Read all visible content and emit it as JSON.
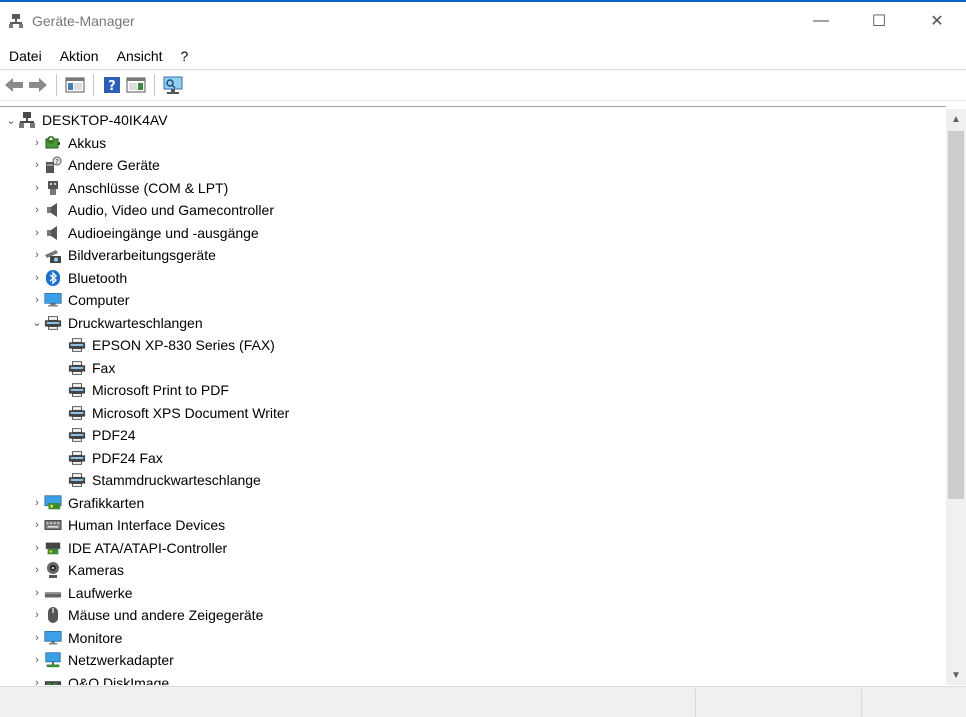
{
  "window": {
    "title": "Geräte-Manager",
    "controls": [
      "—",
      "☐",
      "✕"
    ]
  },
  "menu": [
    "Datei",
    "Aktion",
    "Ansicht",
    "?"
  ],
  "toolbar": {
    "buttons": [
      "back-arrow-icon",
      "forward-arrow-icon",
      "console-tree-icon",
      "help-icon",
      "action-pane-icon",
      "monitor-scan-icon"
    ]
  },
  "tree": {
    "root": "DESKTOP-40IK4AV",
    "items": [
      {
        "label": "Akkus",
        "icon": "battery-icon",
        "expanded": false
      },
      {
        "label": "Andere Geräte",
        "icon": "unknown-device-icon",
        "expanded": false
      },
      {
        "label": "Anschlüsse (COM & LPT)",
        "icon": "port-icon",
        "expanded": false
      },
      {
        "label": "Audio, Video und Gamecontroller",
        "icon": "speaker-icon",
        "expanded": false
      },
      {
        "label": "Audioeingänge und -ausgänge",
        "icon": "speaker-icon",
        "expanded": false
      },
      {
        "label": "Bildverarbeitungsgeräte",
        "icon": "camera-device-icon",
        "expanded": false
      },
      {
        "label": "Bluetooth",
        "icon": "bluetooth-icon",
        "expanded": false
      },
      {
        "label": "Computer",
        "icon": "computer-icon",
        "expanded": false
      },
      {
        "label": "Druckwarteschlangen",
        "icon": "printer-icon",
        "expanded": true,
        "children": [
          "EPSON XP-830 Series (FAX)",
          "Fax",
          "Microsoft Print to PDF",
          "Microsoft XPS Document Writer",
          "PDF24",
          "PDF24 Fax",
          "Stammdruckwarteschlange"
        ]
      },
      {
        "label": "Grafikkarten",
        "icon": "display-adapter-icon",
        "expanded": false
      },
      {
        "label": "Human Interface Devices",
        "icon": "hid-icon",
        "expanded": false
      },
      {
        "label": "IDE ATA/ATAPI-Controller",
        "icon": "ide-controller-icon",
        "expanded": false
      },
      {
        "label": "Kameras",
        "icon": "webcam-icon",
        "expanded": false
      },
      {
        "label": "Laufwerke",
        "icon": "drive-icon",
        "expanded": false
      },
      {
        "label": "Mäuse und andere Zeigegeräte",
        "icon": "mouse-icon",
        "expanded": false
      },
      {
        "label": "Monitore",
        "icon": "monitor-icon",
        "expanded": false
      },
      {
        "label": "Netzwerkadapter",
        "icon": "network-adapter-icon",
        "expanded": false
      },
      {
        "label": "O&O DiskImage",
        "icon": "disk-image-icon",
        "expanded": false
      }
    ]
  },
  "colors": {
    "accent": "#0a64c8",
    "title_text": "#767676",
    "scroll_thumb": "#cdcdcd",
    "status_bg": "#f0f0f0"
  }
}
